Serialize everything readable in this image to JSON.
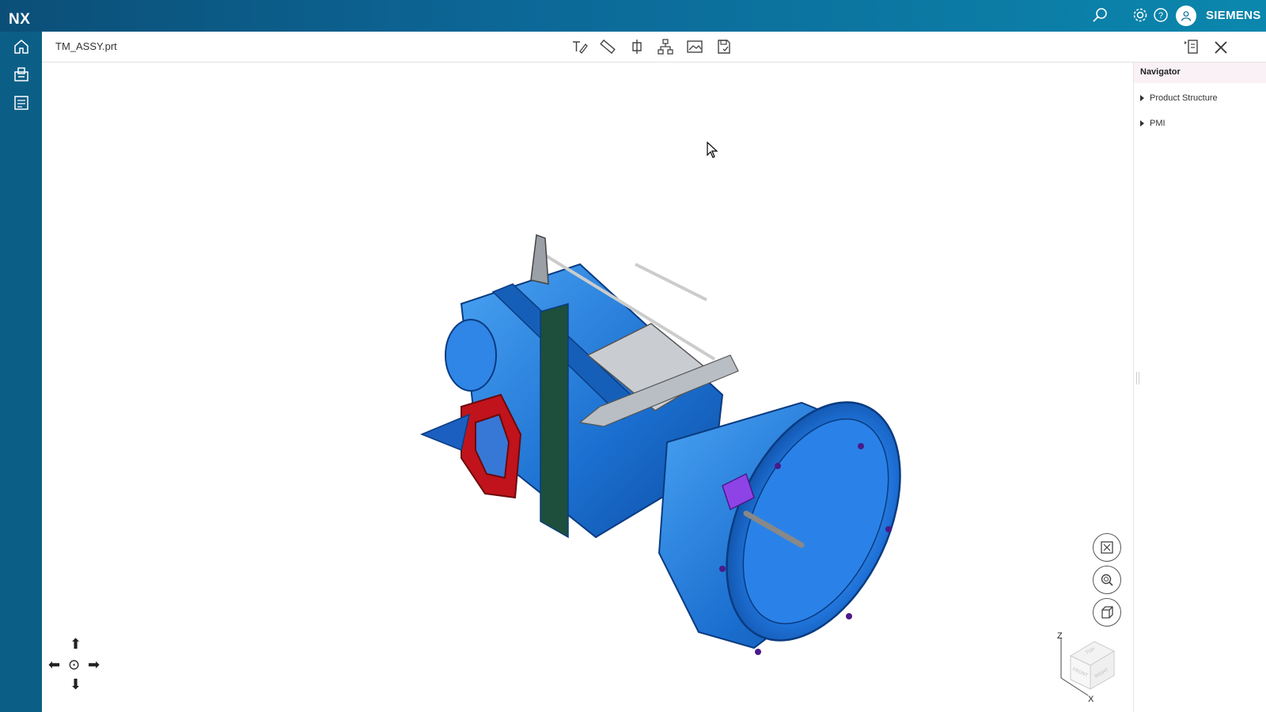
{
  "app": {
    "brand": "NX",
    "vendor": "SIEMENS"
  },
  "topbar": {
    "icons": [
      "search-icon",
      "settings-icon",
      "help-icon",
      "user-icon"
    ]
  },
  "leftrail": {
    "icons": [
      "home-icon",
      "open-part-icon",
      "report-icon"
    ]
  },
  "document": {
    "title": "TM_ASSY.prt",
    "tools": [
      "markup-icon",
      "measure-icon",
      "section-icon",
      "assembly-structure-icon",
      "snapshot-icon",
      "save-icon"
    ],
    "right_icons": [
      "navigator-toggle-icon",
      "close-icon"
    ]
  },
  "navigator": {
    "title": "Navigator",
    "items": [
      {
        "label": "Product Structure"
      },
      {
        "label": "PMI"
      }
    ]
  },
  "view_controls": [
    "fit-view-icon",
    "zoom-icon",
    "view-orientation-icon"
  ],
  "view_cube": {
    "axis_z": "Z",
    "axis_x": "X",
    "face_top": "TOP",
    "face_front": "FRONT",
    "face_right": "RIGHT"
  },
  "colors": {
    "accent": "#0b6a97",
    "model_body": "#1f74d6",
    "model_flange": "#c0131b",
    "model_cover": "#c9cdd2"
  }
}
